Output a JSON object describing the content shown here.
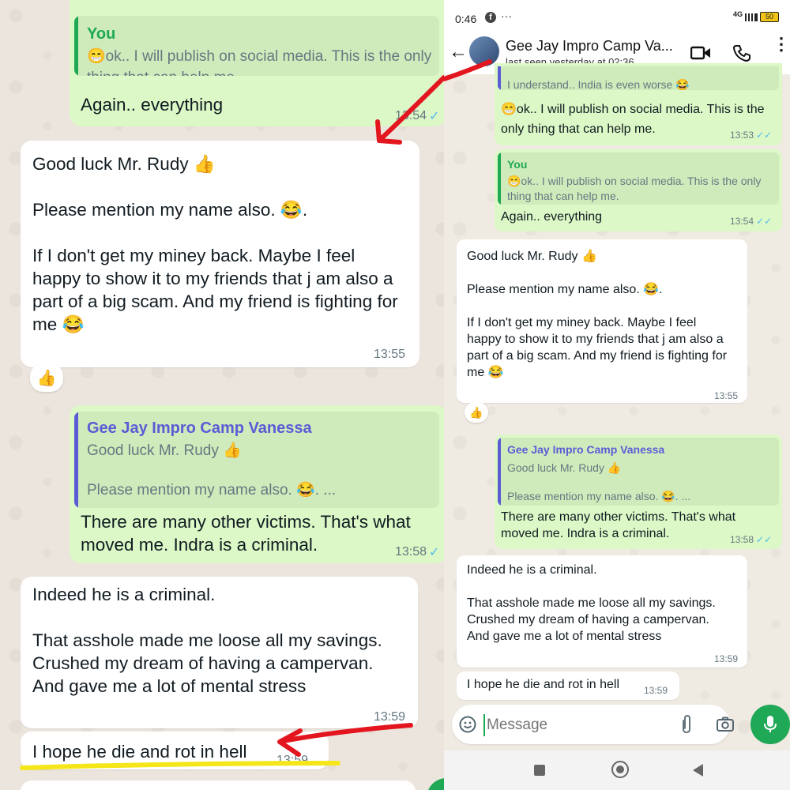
{
  "left": {
    "reply1": {
      "quote_name": "You",
      "quote_text": "😁ok.. I will publish on social media. This is the only thing that can help me.",
      "text": "Again.. everything",
      "time": "13:54"
    },
    "msg2": {
      "text": "Good luck Mr. Rudy 👍\n\nPlease mention my name also. 😂.\n\nIf I don't get my miney back. Maybe I feel happy to show it to my friends that j am also a part of a big scam. And my friend is fighting for me 😂",
      "time": "13:55",
      "reaction": "👍"
    },
    "reply3": {
      "quote_name": "Gee Jay Impro Camp Vanessa",
      "quote_text": "Good luck Mr. Rudy 👍\n\nPlease mention my name also. 😂. ...",
      "text": "There are many other victims. That's what moved me. Indra is a criminal.",
      "time": "13:58"
    },
    "msg4": {
      "text": "Indeed he is a criminal.\n\nThat asshole made me loose all my savings. Crushed my dream of having a campervan. And gave me a lot of mental stress",
      "time": "13:59"
    },
    "msg5": {
      "text": "I hope he die and rot in hell",
      "time": "13:59"
    }
  },
  "right": {
    "status": {
      "time": "0:46",
      "network": "4G",
      "battery": "50"
    },
    "header": {
      "contact_name": "Gee Jay Impro Camp Va...",
      "last_seen": "last seen yesterday at 02:36"
    },
    "msg0": {
      "quote_text": "I understand.. India is even worse 😂",
      "text": "😁ok.. I will publish on social media. This is the only thing that can help me.",
      "time": "13:53"
    },
    "reply1": {
      "quote_name": "You",
      "quote_text": "😁ok.. I will publish on social media. This is the only thing that can help me.",
      "text": "Again.. everything",
      "time": "13:54"
    },
    "msg2": {
      "text": "Good luck Mr. Rudy 👍\n\nPlease mention my name also. 😂.\n\nIf I don't get my miney back. Maybe I feel happy to show it to my friends that j am also a part of a big scam. And my friend is fighting for me 😂",
      "time": "13:55",
      "reaction": "👍"
    },
    "reply3": {
      "quote_name": "Gee Jay Impro Camp Vanessa",
      "quote_text": "Good luck Mr. Rudy 👍\n\nPlease mention my name also. 😂. ...",
      "text": "There are many other victims. That's what moved me. Indra is a criminal.",
      "time": "13:58"
    },
    "msg4": {
      "text": "Indeed he is a criminal.\n\nThat asshole made me loose all my savings. Crushed my dream of having a campervan. And gave me a lot of mental stress",
      "time": "13:59"
    },
    "msg5": {
      "text": "I hope he die and rot in hell",
      "time": "13:59"
    },
    "composer": {
      "placeholder": "Message"
    }
  },
  "colors": {
    "you_name": "#1fa855",
    "vanessa_name": "#5c5bd6",
    "annotation_red": "#e3151f",
    "highlight_yellow": "#f5e61a"
  }
}
